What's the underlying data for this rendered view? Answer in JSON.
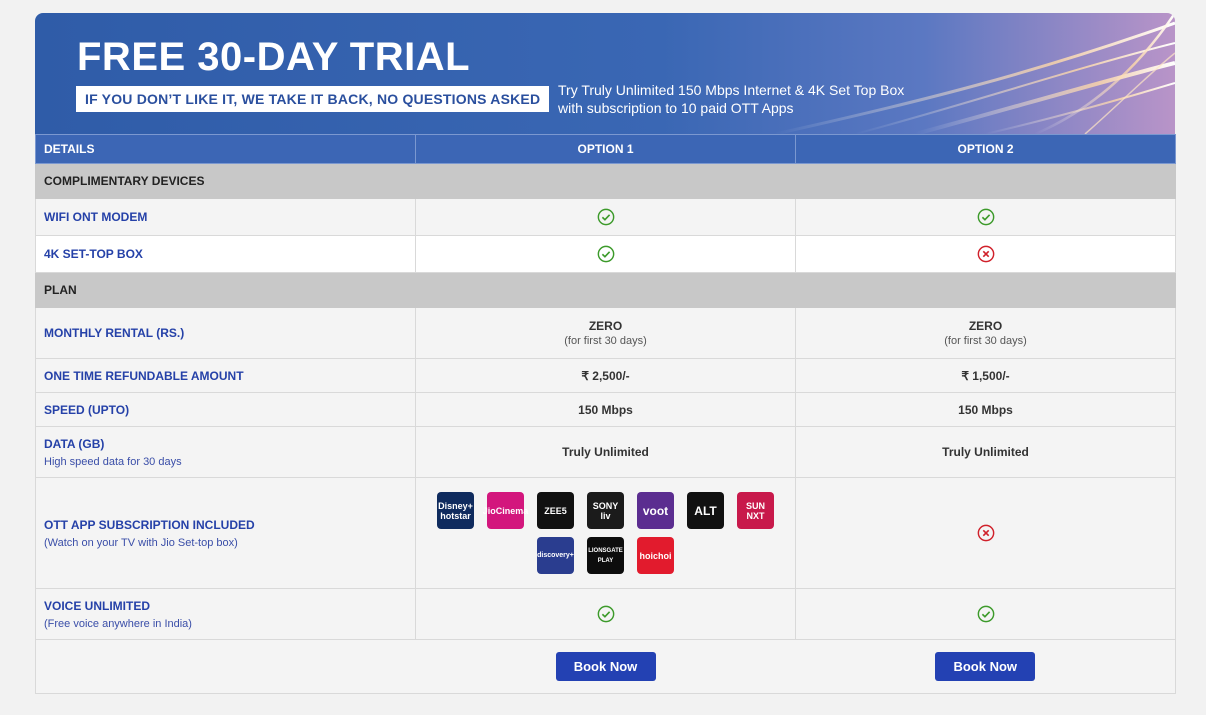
{
  "banner": {
    "title": "FREE 30-DAY TRIAL",
    "tagline": "IF YOU DON’T LIKE IT, WE TAKE IT BACK, NO QUESTIONS ASKED",
    "desc_line1": "Try Truly Unlimited 150 Mbps Internet & 4K Set Top Box",
    "desc_line2": "with subscription to 10 paid OTT Apps"
  },
  "table": {
    "headers": [
      "DETAILS",
      "OPTION 1",
      "OPTION 2"
    ],
    "section_devices": "COMPLIMENTARY DEVICES",
    "section_plan": "PLAN",
    "rows": {
      "wifi": {
        "label": "WIFI ONT MODEM",
        "opt1": "included",
        "opt2": "included"
      },
      "stb": {
        "label": "4K SET-TOP BOX",
        "opt1": "included",
        "opt2": "not-included"
      },
      "rental": {
        "label": "MONTHLY RENTAL (RS.)",
        "opt1": "ZERO",
        "opt1_note": "(for first 30 days)",
        "opt2": "ZERO",
        "opt2_note": "(for first 30 days)"
      },
      "refund": {
        "label": "ONE TIME REFUNDABLE AMOUNT",
        "opt1": "₹ 2,500/-",
        "opt2": "₹ 1,500/-"
      },
      "speed": {
        "label": "SPEED (UPTO)",
        "opt1": "150 Mbps",
        "opt2": "150 Mbps"
      },
      "data": {
        "label": "DATA (GB)",
        "sub": "High speed data for 30 days",
        "opt1": "Truly Unlimited",
        "opt2": "Truly Unlimited"
      },
      "ott": {
        "label": "OTT APP SUBSCRIPTION INCLUDED",
        "sub": "(Watch on your TV with Jio Set-top box)",
        "opt2": "not-included"
      },
      "voice": {
        "label": "VOICE UNLIMITED",
        "sub": "(Free voice anywhere in India)",
        "opt1": "included",
        "opt2": "included"
      }
    },
    "ott_apps": [
      {
        "name": "disney-hotstar",
        "text": "Disney+ hotstar",
        "color": "#0f2b5e"
      },
      {
        "name": "jiocinema",
        "text": "JioCinema",
        "color": "#d3167d"
      },
      {
        "name": "zee5",
        "text": "ZEE5",
        "color": "#111111"
      },
      {
        "name": "sonyliv",
        "text": "SONY liv",
        "color": "#1b1b1b"
      },
      {
        "name": "voot",
        "text": "voot",
        "color": "#5b2d90"
      },
      {
        "name": "altbalaji",
        "text": "ALT",
        "color": "#111111"
      },
      {
        "name": "sunnxt",
        "text": "SUN NXT",
        "color": "#c8194b"
      },
      {
        "name": "discovery-plus",
        "text": "discovery+",
        "color": "#2a3d8f"
      },
      {
        "name": "lionsgate-play",
        "text": "LIONSGATE PLAY",
        "color": "#0d0d0d"
      },
      {
        "name": "hoichoi",
        "text": "hoichoi",
        "color": "#e21b2d"
      }
    ],
    "book_label_1": "Book Now",
    "book_label_2": "Book Now"
  },
  "colors": {
    "included": "#3c9a2a",
    "not_included": "#d0202a",
    "button": "#2341b3",
    "header": "#3c66b5"
  }
}
